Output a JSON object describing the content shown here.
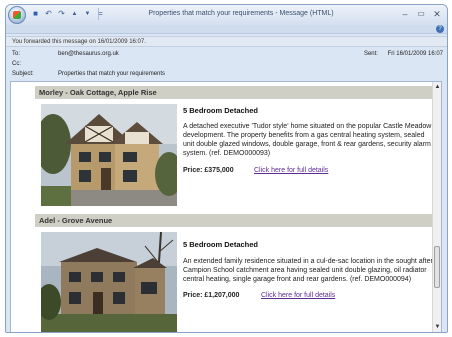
{
  "window": {
    "title": "Properties that match your requirements - Message (HTML)",
    "controls": {
      "minimize": "–",
      "maximize": "▭",
      "close": "✕"
    }
  },
  "quick_access": [
    {
      "icon": "save-icon",
      "glyph": "■"
    },
    {
      "icon": "undo-icon",
      "glyph": "↶"
    },
    {
      "icon": "redo-icon",
      "glyph": "↷"
    },
    {
      "icon": "up-arrow-icon",
      "glyph": "▲"
    },
    {
      "icon": "down-arrow-icon",
      "glyph": "▼"
    },
    {
      "icon": "customize-icon",
      "glyph": "="
    }
  ],
  "info_bar": {
    "text": "You forwarded this message on 16/01/2009 16:07."
  },
  "headers": {
    "to_label": "To:",
    "to_value": "ben@thesaurus.org.uk",
    "cc_label": "Cc:",
    "cc_value": "",
    "subject_label": "Subject:",
    "subject_value": "Properties that match your requirements",
    "sent_label": "Sent:",
    "sent_value": "Fri 16/01/2009 16:07"
  },
  "listings": [
    {
      "heading": "Morley - Oak Cottage, Apple Rise",
      "type": "5 Bedroom Detached",
      "description": "A detached executive 'Tudor style' home situated on the popular Castle Meadow development. The property benefits from a gas central heating system, sealed unit double glazed windows, double garage, front & rear gardens, security alarm system. (ref. DEMO000093)",
      "price": "Price: £375,000",
      "link": "Click here for full details"
    },
    {
      "heading": "Adel - Grove Avenue",
      "type": "5 Bedroom Detached",
      "description": "An extended family residence situated in a cul-de-sac location in the sought after Campion School catchment area having sealed unit double glazing, oil radiator central heating, single garage front and rear gardens. (ref. DEMO000094)",
      "price": "Price: £1,207,000",
      "link": "Click here for full details"
    }
  ],
  "colors": {
    "link": "#5b2c91",
    "listing_header_bg": "#cfcfc5",
    "window_frame": "#dbe6f4"
  }
}
